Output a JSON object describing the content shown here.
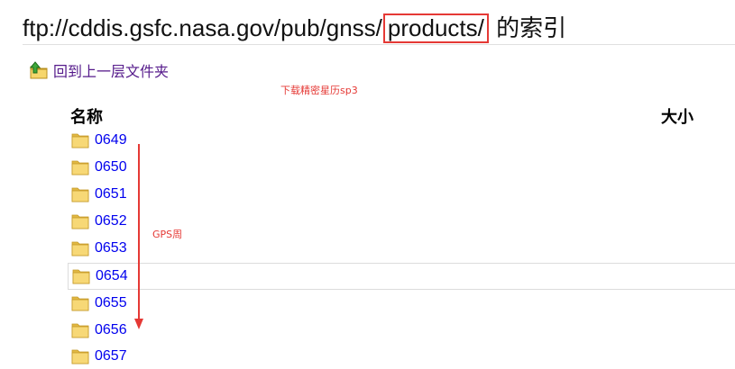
{
  "header": {
    "title_prefix": "ftp://cddis.gsfc.nasa.gov/pub/gnss/",
    "title_highlight": "products/",
    "title_suffix": " 的索引"
  },
  "nav": {
    "up_label": "回到上一层文件夹"
  },
  "annotations": {
    "sp3": "下载精密星历sp3",
    "gps_week": "GPS周"
  },
  "table": {
    "col_name": "名称",
    "col_size": "大小",
    "rows": [
      {
        "name": "0649"
      },
      {
        "name": "0650"
      },
      {
        "name": "0651"
      },
      {
        "name": "0652"
      },
      {
        "name": "0653"
      },
      {
        "name": "0654"
      },
      {
        "name": "0655"
      },
      {
        "name": "0656"
      },
      {
        "name": "0657"
      }
    ]
  },
  "colors": {
    "highlight_box": "#e53935",
    "link": "#0000ee",
    "visited_link": "#551a8b",
    "annotation": "#e53935"
  },
  "icons": {
    "up": "up-arrow-folder-icon",
    "folder": "folder-icon"
  }
}
